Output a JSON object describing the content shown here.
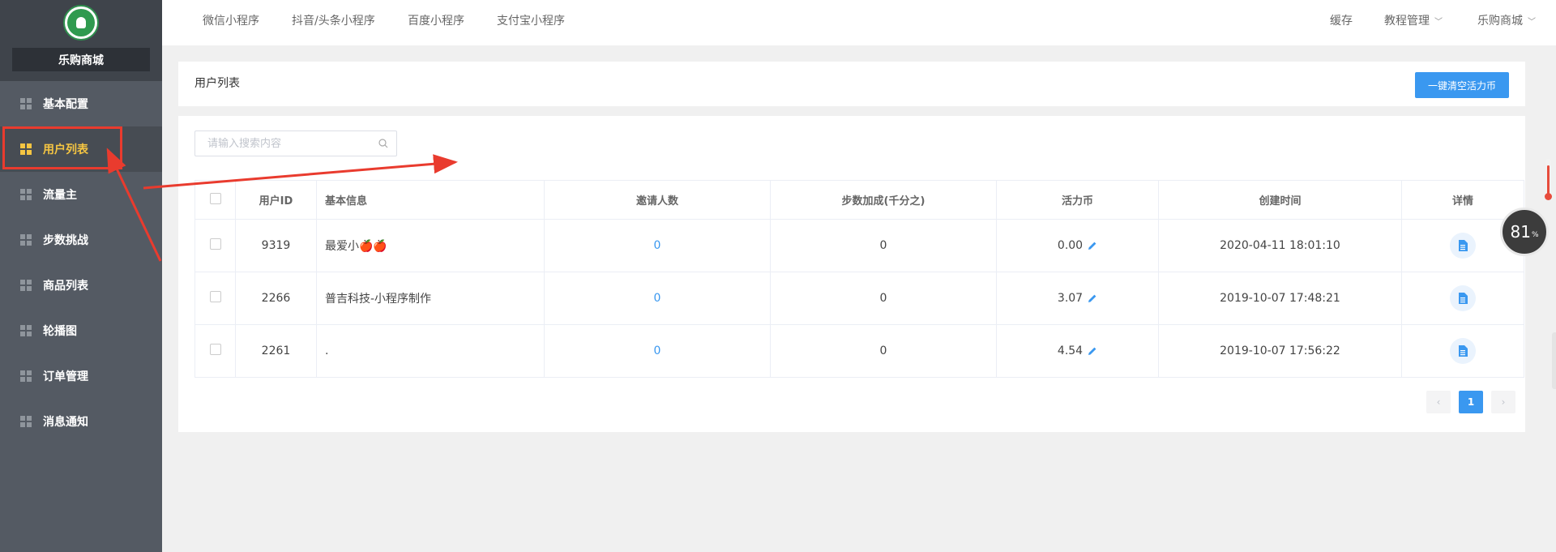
{
  "brand": {
    "name": "乐购商城"
  },
  "sidebar": {
    "items": [
      {
        "label": "基本配置",
        "active": false
      },
      {
        "label": "用户列表",
        "active": true
      },
      {
        "label": "流量主",
        "active": false
      },
      {
        "label": "步数挑战",
        "active": false
      },
      {
        "label": "商品列表",
        "active": false
      },
      {
        "label": "轮播图",
        "active": false
      },
      {
        "label": "订单管理",
        "active": false
      },
      {
        "label": "消息通知",
        "active": false
      }
    ]
  },
  "header": {
    "tabs": [
      "微信小程序",
      "抖音/头条小程序",
      "百度小程序",
      "支付宝小程序"
    ],
    "right": {
      "cache": "缓存",
      "tutorial": "教程管理",
      "store": "乐购商城"
    }
  },
  "page": {
    "title": "用户列表",
    "clear_button": "一键清空活力币",
    "search_placeholder": "请输入搜索内容"
  },
  "table": {
    "columns": [
      "用户ID",
      "基本信息",
      "邀请人数",
      "步数加成(千分之)",
      "活力币",
      "创建时间",
      "详情"
    ],
    "rows": [
      {
        "id": "9319",
        "info": "最爱小🍎🍎",
        "invites": "0",
        "bonus": "0",
        "coins": "0.00",
        "created": "2020-04-11 18:01:10"
      },
      {
        "id": "2266",
        "info": "普吉科技-小程序制作",
        "invites": "0",
        "bonus": "0",
        "coins": "3.07",
        "created": "2019-10-07 17:48:21"
      },
      {
        "id": "2261",
        "info": ".",
        "invites": "0",
        "bonus": "0",
        "coins": "4.54",
        "created": "2019-10-07 17:56:22"
      }
    ]
  },
  "pagination": {
    "prev": "‹",
    "current": "1",
    "next": "›"
  },
  "widget": {
    "value": "81",
    "unit": "%"
  },
  "colors": {
    "accent": "#3a98f0",
    "sidebar": "#545a63",
    "active": "#f5c542",
    "annotation": "#e93b2e"
  }
}
